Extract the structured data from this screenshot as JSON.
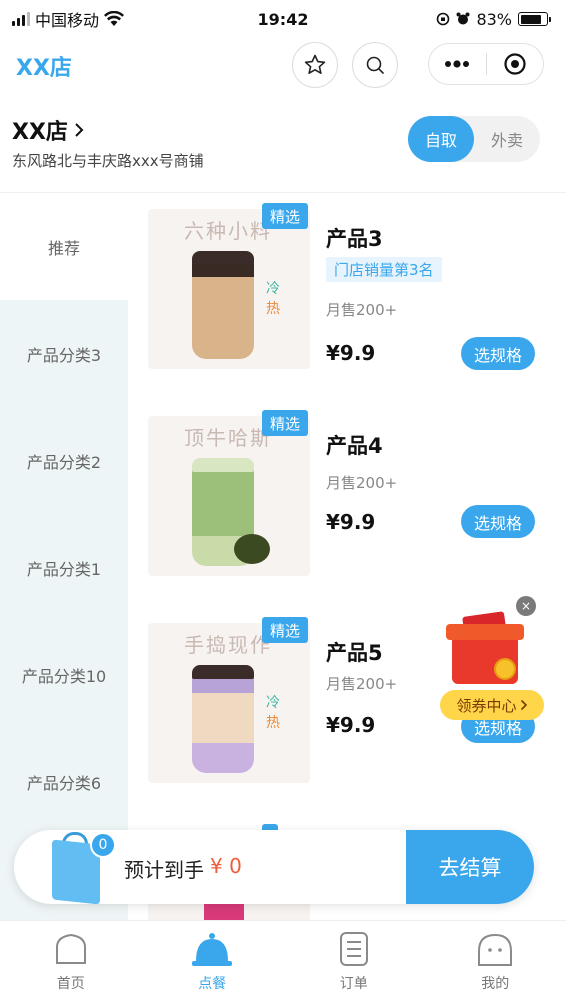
{
  "status_bar": {
    "carrier": "中国移动",
    "time": "19:42",
    "battery": "83%",
    "battery_level": 0.83
  },
  "nav": {
    "title": "XX店",
    "icons": [
      "star-icon",
      "search-icon",
      "more-dots-icon",
      "record-target-icon"
    ]
  },
  "store": {
    "name": "XX店",
    "address": "东风路北与丰庆路xxx号商铺",
    "modes": [
      {
        "label": "自取",
        "active": true
      },
      {
        "label": "外卖",
        "active": false
      }
    ]
  },
  "sidebar": {
    "items": [
      {
        "label": "推荐",
        "active": true
      },
      {
        "label": "产品分类3",
        "active": false
      },
      {
        "label": "产品分类2",
        "active": false
      },
      {
        "label": "产品分类1",
        "active": false
      },
      {
        "label": "产品分类10",
        "active": false
      },
      {
        "label": "产品分类6",
        "active": false
      }
    ]
  },
  "products": [
    {
      "badge": "精选",
      "image_caption": "六种小料",
      "image_tag": "冷热",
      "name": "产品3",
      "rank": "门店销量第3名",
      "sales": "月售200+",
      "price": "¥9.9",
      "button": "选规格"
    },
    {
      "badge": "精选",
      "image_caption": "顶牛哈斯",
      "name": "产品4",
      "sales": "月售200+",
      "price": "¥9.9",
      "button": "选规格"
    },
    {
      "badge": "精选",
      "image_caption": "手捣现作",
      "image_tag": "冷热",
      "name": "产品5",
      "sales": "月售200+",
      "price": "¥9.9",
      "button": "选规格"
    }
  ],
  "coupon": {
    "label": "领券中心",
    "close": "×"
  },
  "cart": {
    "count": "0",
    "estimate_label": "预计到手",
    "amount": "¥ 0",
    "checkout": "去结算"
  },
  "tabs": [
    {
      "label": "首页",
      "icon": "home-icon",
      "active": false
    },
    {
      "label": "点餐",
      "icon": "order-bell-icon",
      "active": true
    },
    {
      "label": "订单",
      "icon": "order-list-icon",
      "active": false
    },
    {
      "label": "我的",
      "icon": "profile-icon",
      "active": false
    }
  ],
  "colors": {
    "accent": "#3aa7ec",
    "price_highlight": "#f25b3a",
    "sidebar_bg": "#eef5f6",
    "coupon_yellow": "#ffd54a"
  }
}
